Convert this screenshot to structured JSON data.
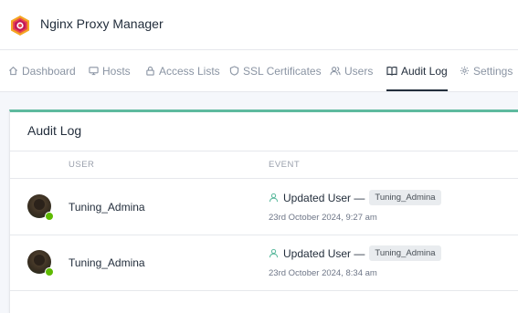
{
  "app": {
    "title": "Nginx Proxy Manager"
  },
  "nav": {
    "tabs": [
      {
        "label": "Dashboard",
        "icon": "home-icon"
      },
      {
        "label": "Hosts",
        "icon": "monitor-icon"
      },
      {
        "label": "Access Lists",
        "icon": "lock-icon"
      },
      {
        "label": "SSL Certificates",
        "icon": "shield-icon"
      },
      {
        "label": "Users",
        "icon": "users-icon"
      },
      {
        "label": "Audit Log",
        "icon": "book-icon",
        "active": true
      },
      {
        "label": "Settings",
        "icon": "gear-icon"
      }
    ]
  },
  "audit": {
    "title": "Audit Log",
    "columns": {
      "user": "USER",
      "event": "EVENT"
    },
    "rows": [
      {
        "user": "Tuning_Admina",
        "event_text": "Updated User —",
        "event_tag": "Tuning_Admina",
        "time": "23rd October 2024, 9:27 am",
        "online": true
      },
      {
        "user": "Tuning_Admina",
        "event_text": "Updated User —",
        "event_tag": "Tuning_Admina",
        "time": "23rd October 2024, 8:34 am",
        "online": true
      }
    ]
  },
  "colors": {
    "accent": "#5eba9f",
    "online": "#5eba00",
    "logo": "#e8474a"
  }
}
